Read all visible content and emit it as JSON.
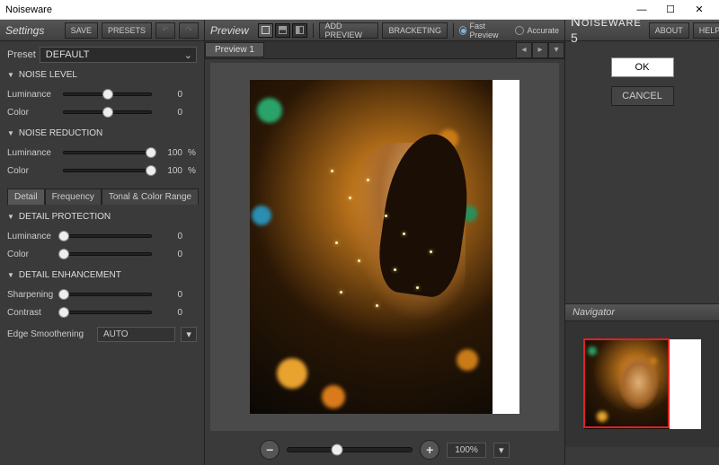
{
  "window": {
    "title": "Noiseware"
  },
  "brand": {
    "name": "NOISEWARE",
    "version": "5",
    "about": "ABOUT",
    "help": "HELP"
  },
  "actions": {
    "ok": "OK",
    "cancel": "CANCEL"
  },
  "settings": {
    "title": "Settings",
    "save": "SAVE",
    "presets": "PRESETS",
    "preset_label": "Preset",
    "preset_value": "DEFAULT",
    "noise_level": {
      "title": "NOISE LEVEL",
      "luminance": {
        "label": "Luminance",
        "value": "0",
        "pos": 50
      },
      "color": {
        "label": "Color",
        "value": "0",
        "pos": 50
      }
    },
    "noise_reduction": {
      "title": "NOISE REDUCTION",
      "luminance": {
        "label": "Luminance",
        "value": "100",
        "unit": "%",
        "pos": 100
      },
      "color": {
        "label": "Color",
        "value": "100",
        "unit": "%",
        "pos": 100
      }
    },
    "tabs": {
      "detail": "Detail",
      "frequency": "Frequency",
      "tonal": "Tonal & Color Range",
      "active": "detail"
    },
    "detail_protection": {
      "title": "DETAIL PROTECTION",
      "luminance": {
        "label": "Luminance",
        "value": "0",
        "pos": 0
      },
      "color": {
        "label": "Color",
        "value": "0",
        "pos": 0
      }
    },
    "detail_enhancement": {
      "title": "DETAIL ENHANCEMENT",
      "sharpening": {
        "label": "Sharpening",
        "value": "0",
        "pos": 0
      },
      "contrast": {
        "label": "Contrast",
        "value": "0",
        "pos": 0
      },
      "edge_label": "Edge Smoothening",
      "edge_value": "AUTO"
    }
  },
  "preview": {
    "title": "Preview",
    "add_preview": "ADD PREVIEW",
    "bracketing": "BRACKETING",
    "fast": "Fast Preview",
    "accurate": "Accurate",
    "mode": "fast",
    "tab": "Preview 1",
    "zoom": "100%"
  },
  "navigator": {
    "title": "Navigator"
  }
}
